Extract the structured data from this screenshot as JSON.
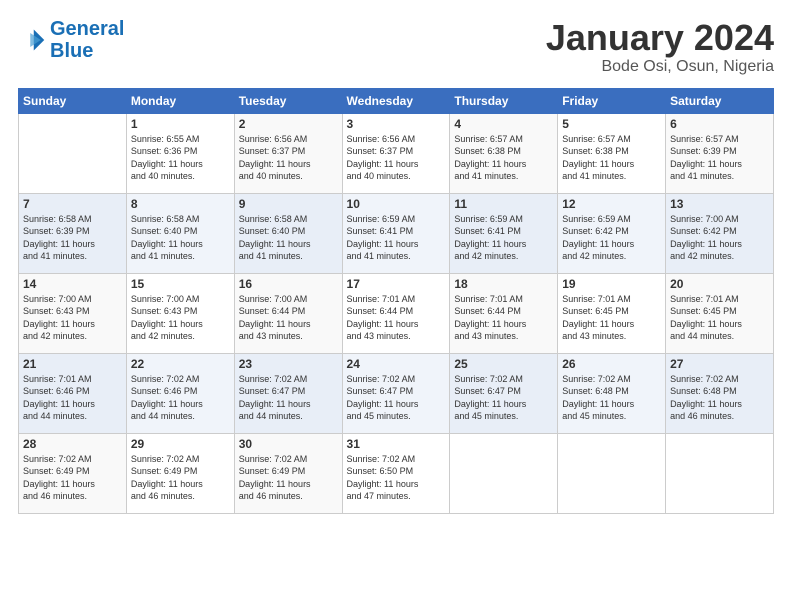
{
  "logo": {
    "text_general": "General",
    "text_blue": "Blue"
  },
  "header": {
    "title": "January 2024",
    "subtitle": "Bode Osi, Osun, Nigeria"
  },
  "columns": [
    "Sunday",
    "Monday",
    "Tuesday",
    "Wednesday",
    "Thursday",
    "Friday",
    "Saturday"
  ],
  "weeks": [
    [
      {
        "num": "",
        "detail": ""
      },
      {
        "num": "1",
        "detail": "Sunrise: 6:55 AM\nSunset: 6:36 PM\nDaylight: 11 hours\nand 40 minutes."
      },
      {
        "num": "2",
        "detail": "Sunrise: 6:56 AM\nSunset: 6:37 PM\nDaylight: 11 hours\nand 40 minutes."
      },
      {
        "num": "3",
        "detail": "Sunrise: 6:56 AM\nSunset: 6:37 PM\nDaylight: 11 hours\nand 40 minutes."
      },
      {
        "num": "4",
        "detail": "Sunrise: 6:57 AM\nSunset: 6:38 PM\nDaylight: 11 hours\nand 41 minutes."
      },
      {
        "num": "5",
        "detail": "Sunrise: 6:57 AM\nSunset: 6:38 PM\nDaylight: 11 hours\nand 41 minutes."
      },
      {
        "num": "6",
        "detail": "Sunrise: 6:57 AM\nSunset: 6:39 PM\nDaylight: 11 hours\nand 41 minutes."
      }
    ],
    [
      {
        "num": "7",
        "detail": "Sunrise: 6:58 AM\nSunset: 6:39 PM\nDaylight: 11 hours\nand 41 minutes."
      },
      {
        "num": "8",
        "detail": "Sunrise: 6:58 AM\nSunset: 6:40 PM\nDaylight: 11 hours\nand 41 minutes."
      },
      {
        "num": "9",
        "detail": "Sunrise: 6:58 AM\nSunset: 6:40 PM\nDaylight: 11 hours\nand 41 minutes."
      },
      {
        "num": "10",
        "detail": "Sunrise: 6:59 AM\nSunset: 6:41 PM\nDaylight: 11 hours\nand 41 minutes."
      },
      {
        "num": "11",
        "detail": "Sunrise: 6:59 AM\nSunset: 6:41 PM\nDaylight: 11 hours\nand 42 minutes."
      },
      {
        "num": "12",
        "detail": "Sunrise: 6:59 AM\nSunset: 6:42 PM\nDaylight: 11 hours\nand 42 minutes."
      },
      {
        "num": "13",
        "detail": "Sunrise: 7:00 AM\nSunset: 6:42 PM\nDaylight: 11 hours\nand 42 minutes."
      }
    ],
    [
      {
        "num": "14",
        "detail": "Sunrise: 7:00 AM\nSunset: 6:43 PM\nDaylight: 11 hours\nand 42 minutes."
      },
      {
        "num": "15",
        "detail": "Sunrise: 7:00 AM\nSunset: 6:43 PM\nDaylight: 11 hours\nand 42 minutes."
      },
      {
        "num": "16",
        "detail": "Sunrise: 7:00 AM\nSunset: 6:44 PM\nDaylight: 11 hours\nand 43 minutes."
      },
      {
        "num": "17",
        "detail": "Sunrise: 7:01 AM\nSunset: 6:44 PM\nDaylight: 11 hours\nand 43 minutes."
      },
      {
        "num": "18",
        "detail": "Sunrise: 7:01 AM\nSunset: 6:44 PM\nDaylight: 11 hours\nand 43 minutes."
      },
      {
        "num": "19",
        "detail": "Sunrise: 7:01 AM\nSunset: 6:45 PM\nDaylight: 11 hours\nand 43 minutes."
      },
      {
        "num": "20",
        "detail": "Sunrise: 7:01 AM\nSunset: 6:45 PM\nDaylight: 11 hours\nand 44 minutes."
      }
    ],
    [
      {
        "num": "21",
        "detail": "Sunrise: 7:01 AM\nSunset: 6:46 PM\nDaylight: 11 hours\nand 44 minutes."
      },
      {
        "num": "22",
        "detail": "Sunrise: 7:02 AM\nSunset: 6:46 PM\nDaylight: 11 hours\nand 44 minutes."
      },
      {
        "num": "23",
        "detail": "Sunrise: 7:02 AM\nSunset: 6:47 PM\nDaylight: 11 hours\nand 44 minutes."
      },
      {
        "num": "24",
        "detail": "Sunrise: 7:02 AM\nSunset: 6:47 PM\nDaylight: 11 hours\nand 45 minutes."
      },
      {
        "num": "25",
        "detail": "Sunrise: 7:02 AM\nSunset: 6:47 PM\nDaylight: 11 hours\nand 45 minutes."
      },
      {
        "num": "26",
        "detail": "Sunrise: 7:02 AM\nSunset: 6:48 PM\nDaylight: 11 hours\nand 45 minutes."
      },
      {
        "num": "27",
        "detail": "Sunrise: 7:02 AM\nSunset: 6:48 PM\nDaylight: 11 hours\nand 46 minutes."
      }
    ],
    [
      {
        "num": "28",
        "detail": "Sunrise: 7:02 AM\nSunset: 6:49 PM\nDaylight: 11 hours\nand 46 minutes."
      },
      {
        "num": "29",
        "detail": "Sunrise: 7:02 AM\nSunset: 6:49 PM\nDaylight: 11 hours\nand 46 minutes."
      },
      {
        "num": "30",
        "detail": "Sunrise: 7:02 AM\nSunset: 6:49 PM\nDaylight: 11 hours\nand 46 minutes."
      },
      {
        "num": "31",
        "detail": "Sunrise: 7:02 AM\nSunset: 6:50 PM\nDaylight: 11 hours\nand 47 minutes."
      },
      {
        "num": "",
        "detail": ""
      },
      {
        "num": "",
        "detail": ""
      },
      {
        "num": "",
        "detail": ""
      }
    ]
  ]
}
